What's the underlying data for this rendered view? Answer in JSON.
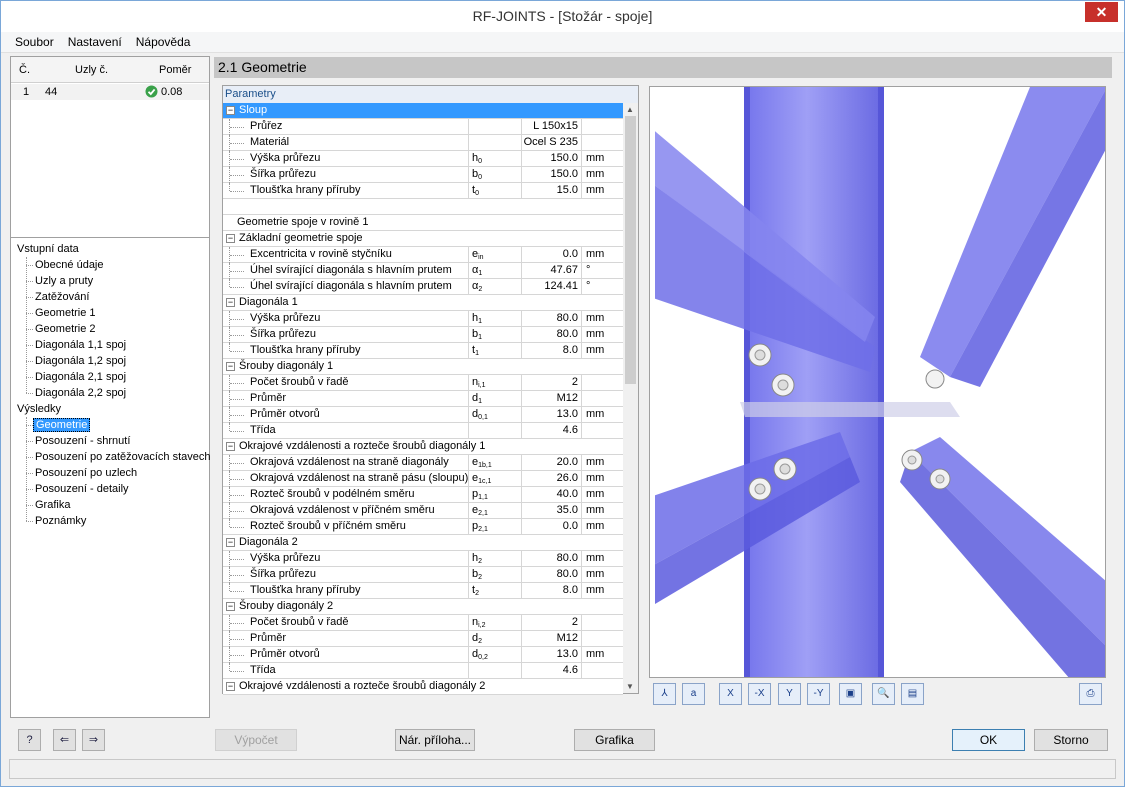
{
  "window": {
    "title": "RF-JOINTS - [Stožár - spoje]",
    "close": "✕"
  },
  "menu": [
    "Soubor",
    "Nastavení",
    "Nápověda"
  ],
  "jointsTable": {
    "headers": [
      "Č.",
      "Uzly č.",
      "Poměr"
    ],
    "rows": [
      {
        "no": "1",
        "nodes": "44",
        "ratio": "0.08"
      }
    ],
    "ok_color": "#3aa14a"
  },
  "tree": {
    "input": {
      "label": "Vstupní data",
      "items": [
        "Obecné údaje",
        "Uzly a pruty",
        "Zatěžování",
        "Geometrie 1",
        "Geometrie 2",
        "Diagonála 1,1 spoj",
        "Diagonála 1,2 spoj",
        "Diagonála 2,1 spoj",
        "Diagonála 2,2 spoj"
      ]
    },
    "results": {
      "label": "Výsledky",
      "items": [
        "Geometrie",
        "Posouzení - shrnutí",
        "Posouzení po zatěžovacích stavech",
        "Posouzení po uzlech",
        "Posouzení - detaily",
        "Grafika",
        "Poznámky"
      ],
      "selected": "Geometrie"
    }
  },
  "section_title": "2.1 Geometrie",
  "params": {
    "title": "Parametry",
    "rows": [
      {
        "t": "g",
        "label": "Sloup",
        "hl": true
      },
      {
        "t": "r",
        "label": "Průřez",
        "sym": "",
        "sub": "",
        "val": "L 150x15",
        "unit": ""
      },
      {
        "t": "r",
        "label": "Materiál",
        "sym": "",
        "sub": "",
        "val": "Ocel S 235",
        "unit": ""
      },
      {
        "t": "r",
        "label": "Výška průřezu",
        "sym": "h",
        "sub": "0",
        "val": "150.0",
        "unit": "mm"
      },
      {
        "t": "r",
        "label": "Šířka průřezu",
        "sym": "b",
        "sub": "0",
        "val": "150.0",
        "unit": "mm"
      },
      {
        "t": "r",
        "label": "Tloušťka hrany příruby",
        "sym": "t",
        "sub": "0",
        "val": "15.0",
        "unit": "mm",
        "last": true
      },
      {
        "t": "e"
      },
      {
        "t": "p",
        "label": "Geometrie spoje v rovině 1"
      },
      {
        "t": "g",
        "label": "Základní geometrie spoje"
      },
      {
        "t": "r",
        "label": "Excentricita v rovině styčníku",
        "sym": "e",
        "sub": "in",
        "val": "0.0",
        "unit": "mm"
      },
      {
        "t": "r",
        "label": "Úhel svírající diagonála s hlavním prutem",
        "sym": "α",
        "sub": "1",
        "val": "47.67",
        "unit": "°"
      },
      {
        "t": "r",
        "label": "Úhel svírající diagonála s hlavním prutem",
        "sym": "α",
        "sub": "2",
        "val": "124.41",
        "unit": "°",
        "last": true
      },
      {
        "t": "g",
        "label": "Diagonála 1"
      },
      {
        "t": "r",
        "label": "Výška průřezu",
        "sym": "h",
        "sub": "1",
        "val": "80.0",
        "unit": "mm"
      },
      {
        "t": "r",
        "label": "Šířka průřezu",
        "sym": "b",
        "sub": "1",
        "val": "80.0",
        "unit": "mm"
      },
      {
        "t": "r",
        "label": "Tloušťka hrany příruby",
        "sym": "t",
        "sub": "1",
        "val": "8.0",
        "unit": "mm",
        "last": true
      },
      {
        "t": "g",
        "label": "Šrouby diagonály 1"
      },
      {
        "t": "r",
        "label": "Počet šroubů v řadě",
        "sym": "n",
        "sub": "i,1",
        "val": "2",
        "unit": ""
      },
      {
        "t": "r",
        "label": "Průměr",
        "sym": "d",
        "sub": "1",
        "val": "M12",
        "unit": ""
      },
      {
        "t": "r",
        "label": "Průměr otvorů",
        "sym": "d",
        "sub": "0,1",
        "val": "13.0",
        "unit": "mm"
      },
      {
        "t": "r",
        "label": "Třída",
        "sym": "",
        "sub": "",
        "val": "4.6",
        "unit": "",
        "last": true
      },
      {
        "t": "g",
        "label": "Okrajové vzdálenosti a rozteče šroubů diagonály 1"
      },
      {
        "t": "r",
        "label": "Okrajová vzdálenost na straně diagonály",
        "sym": "e",
        "sub": "1b,1",
        "val": "20.0",
        "unit": "mm"
      },
      {
        "t": "r",
        "label": "Okrajová vzdálenost na straně pásu (sloupu)",
        "sym": "e",
        "sub": "1c,1",
        "val": "26.0",
        "unit": "mm"
      },
      {
        "t": "r",
        "label": "Rozteč šroubů v podélném směru",
        "sym": "p",
        "sub": "1,1",
        "val": "40.0",
        "unit": "mm"
      },
      {
        "t": "r",
        "label": "Okrajová vzdálenost v příčném směru",
        "sym": "e",
        "sub": "2,1",
        "val": "35.0",
        "unit": "mm"
      },
      {
        "t": "r",
        "label": "Rozteč šroubů v příčném směru",
        "sym": "p",
        "sub": "2,1",
        "val": "0.0",
        "unit": "mm",
        "last": true
      },
      {
        "t": "g",
        "label": "Diagonála 2"
      },
      {
        "t": "r",
        "label": "Výška průřezu",
        "sym": "h",
        "sub": "2",
        "val": "80.0",
        "unit": "mm"
      },
      {
        "t": "r",
        "label": "Šířka průřezu",
        "sym": "b",
        "sub": "2",
        "val": "80.0",
        "unit": "mm"
      },
      {
        "t": "r",
        "label": "Tloušťka hrany příruby",
        "sym": "t",
        "sub": "2",
        "val": "8.0",
        "unit": "mm",
        "last": true
      },
      {
        "t": "g",
        "label": "Šrouby diagonály 2"
      },
      {
        "t": "r",
        "label": "Počet šroubů v řadě",
        "sym": "n",
        "sub": "i,2",
        "val": "2",
        "unit": ""
      },
      {
        "t": "r",
        "label": "Průměr",
        "sym": "d",
        "sub": "2",
        "val": "M12",
        "unit": ""
      },
      {
        "t": "r",
        "label": "Průměr otvorů",
        "sym": "d",
        "sub": "0,2",
        "val": "13.0",
        "unit": "mm"
      },
      {
        "t": "r",
        "label": "Třída",
        "sym": "",
        "sub": "",
        "val": "4.6",
        "unit": "",
        "last": true
      },
      {
        "t": "g",
        "label": "Okrajové vzdálenosti a rozteče šroubů diagonály 2"
      }
    ]
  },
  "graphic_toolbar": [
    {
      "name": "axis-x-view-icon",
      "glyph": "⅄"
    },
    {
      "name": "axis-numbering-icon",
      "glyph": "a"
    },
    {
      "name": "view-x-icon",
      "glyph": "X"
    },
    {
      "name": "view-minus-x-icon",
      "glyph": "-X"
    },
    {
      "name": "view-y-icon",
      "glyph": "Y"
    },
    {
      "name": "view-minus-y-icon",
      "glyph": "-Y"
    },
    {
      "name": "isometric-view-icon",
      "glyph": "▣"
    },
    {
      "name": "zoom-settings-icon",
      "glyph": "🔍"
    },
    {
      "name": "display-options-icon",
      "glyph": "▤"
    },
    {
      "name": "print-icon",
      "glyph": "⎙"
    }
  ],
  "buttons": {
    "calc": "Výpočet",
    "annex": "Nár. příloha...",
    "graphics": "Grafika",
    "ok": "OK",
    "cancel": "Storno"
  },
  "bottom_icons": [
    {
      "name": "help-icon",
      "glyph": "?"
    },
    {
      "name": "import-icon",
      "glyph": "⇐"
    },
    {
      "name": "export-icon",
      "glyph": "⇒"
    }
  ],
  "colors": {
    "steel": "#6a6ae8",
    "highlight": "#3399ff"
  }
}
